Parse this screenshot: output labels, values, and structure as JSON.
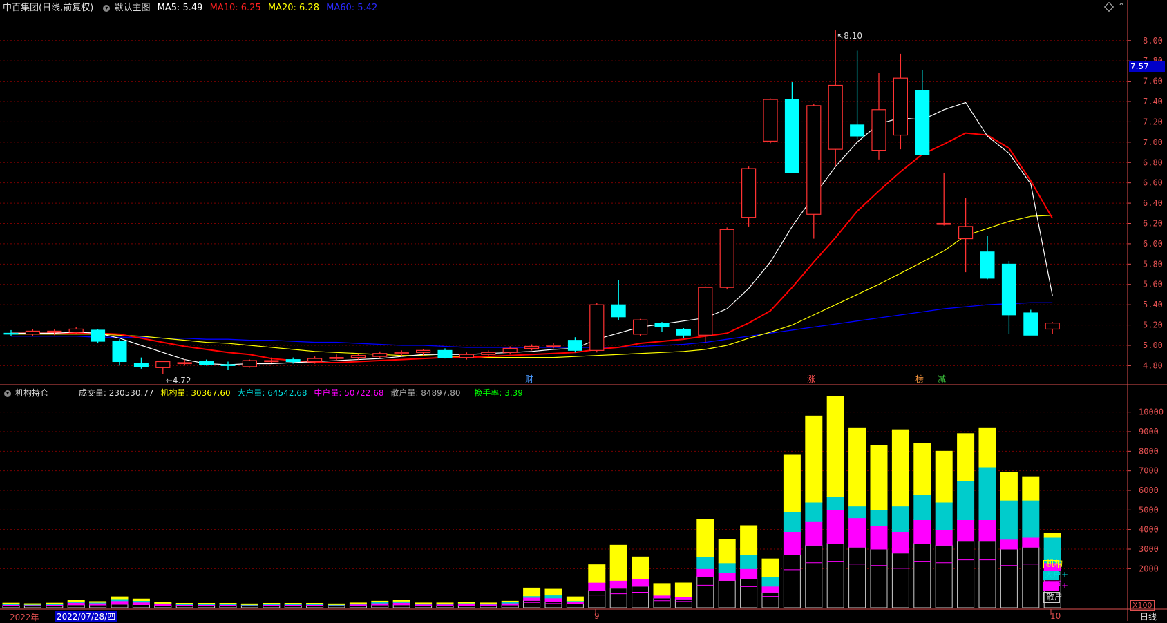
{
  "header": {
    "title": "中百集团",
    "mode": "(日线,前复权)",
    "chart_name": "默认主图",
    "ma5_label": "MA5:",
    "ma5_value": "5.49",
    "ma10_label": "MA10:",
    "ma10_value": "6.25",
    "ma20_label": "MA20:",
    "ma20_value": "6.28",
    "ma60_label": "MA60:",
    "ma60_value": "5.42"
  },
  "indicator_header": {
    "name": "机构持仓",
    "vol_label": "成交量:",
    "vol_value": "230530.77",
    "inst_label": "机构量:",
    "inst_value": "30367.60",
    "big_label": "大户量:",
    "big_value": "64542.68",
    "mid_label": "中户量:",
    "mid_value": "50722.68",
    "retail_label": "散户量:",
    "retail_value": "84897.80",
    "turnover_label": "换手率:",
    "turnover_value": "3.39"
  },
  "price_badge": "7.57",
  "bottom": {
    "year_label": "2022年",
    "date_label": "2022/07/28/四",
    "marker_9": "9",
    "marker_10": "10",
    "period": "日线",
    "unit": "X100"
  },
  "event_markers": [
    "财",
    "涨",
    "榜",
    "减"
  ],
  "legend": [
    {
      "label": "机构-",
      "color": "#ffff00"
    },
    {
      "label": "大户+",
      "color": "#00cccc"
    },
    {
      "label": "中户+",
      "color": "#ff00ff"
    },
    {
      "label": "散户-",
      "color": "#cccccc"
    }
  ],
  "colors": {
    "up": "#ff3232",
    "down": "#00ffff",
    "ma5": "#ffffff",
    "ma10": "#ff0000",
    "ma20": "#ffff00",
    "ma60": "#0000ff",
    "inst": "#ffff00",
    "big": "#00cccc",
    "mid": "#ff00ff",
    "retail": "#cccccc",
    "grid": "#7a0000",
    "axis": "#e05050"
  },
  "chart_data": [
    {
      "type": "candlestick",
      "series": [
        {
          "name": "中百集团"
        }
      ],
      "y_ticks": [
        "8.00",
        "7.80",
        "7.60",
        "7.40",
        "7.20",
        "7.00",
        "6.80",
        "6.60",
        "6.40",
        "6.20",
        "6.00",
        "5.80",
        "5.60",
        "5.40",
        "5.20",
        "5.00",
        "4.80"
      ],
      "ylim": [
        4.66,
        8.25
      ],
      "annotations": {
        "high": "8.10",
        "low": "4.72"
      },
      "candles": [
        [
          5.12,
          5.15,
          5.09,
          5.11
        ],
        [
          5.11,
          5.16,
          5.09,
          5.14
        ],
        [
          5.13,
          5.16,
          5.1,
          5.14
        ],
        [
          5.13,
          5.18,
          5.11,
          5.16
        ],
        [
          5.15,
          5.16,
          5.02,
          5.04
        ],
        [
          5.04,
          5.06,
          4.8,
          4.84
        ],
        [
          4.82,
          4.88,
          4.77,
          4.79
        ],
        [
          4.78,
          4.85,
          4.72,
          4.84
        ],
        [
          4.83,
          4.86,
          4.8,
          4.83
        ],
        [
          4.84,
          4.86,
          4.8,
          4.81
        ],
        [
          4.81,
          4.84,
          4.76,
          4.8
        ],
        [
          4.79,
          4.86,
          4.78,
          4.85
        ],
        [
          4.84,
          4.88,
          4.83,
          4.85
        ],
        [
          4.86,
          4.88,
          4.82,
          4.84
        ],
        [
          4.84,
          4.89,
          4.82,
          4.87
        ],
        [
          4.88,
          4.91,
          4.85,
          4.88
        ],
        [
          4.88,
          4.92,
          4.86,
          4.9
        ],
        [
          4.89,
          4.94,
          4.87,
          4.92
        ],
        [
          4.92,
          4.95,
          4.89,
          4.93
        ],
        [
          4.93,
          4.96,
          4.9,
          4.95
        ],
        [
          4.95,
          4.97,
          4.87,
          4.88
        ],
        [
          4.88,
          4.93,
          4.86,
          4.91
        ],
        [
          4.91,
          4.95,
          4.89,
          4.93
        ],
        [
          4.93,
          4.99,
          4.91,
          4.97
        ],
        [
          4.97,
          5.01,
          4.95,
          4.99
        ],
        [
          4.99,
          5.02,
          4.97,
          5.0
        ],
        [
          5.05,
          5.08,
          4.93,
          4.95
        ],
        [
          4.95,
          5.42,
          4.93,
          5.4
        ],
        [
          5.4,
          5.64,
          5.25,
          5.28
        ],
        [
          5.11,
          5.26,
          5.09,
          5.25
        ],
        [
          5.22,
          5.23,
          5.13,
          5.18
        ],
        [
          5.16,
          5.17,
          5.07,
          5.1
        ],
        [
          5.1,
          5.58,
          5.03,
          5.57
        ],
        [
          5.57,
          6.16,
          5.55,
          6.14
        ],
        [
          6.26,
          6.76,
          6.17,
          6.74
        ],
        [
          7.01,
          7.43,
          6.99,
          7.42
        ],
        [
          7.42,
          7.59,
          6.7,
          6.7
        ],
        [
          6.29,
          7.38,
          6.05,
          7.36
        ],
        [
          6.93,
          8.1,
          6.76,
          7.56
        ],
        [
          7.17,
          7.9,
          7.03,
          7.06
        ],
        [
          6.92,
          7.68,
          6.83,
          7.32
        ],
        [
          7.07,
          7.87,
          6.93,
          7.63
        ],
        [
          7.51,
          7.71,
          6.88,
          6.88
        ],
        [
          6.19,
          6.7,
          6.18,
          6.2
        ],
        [
          6.05,
          6.45,
          5.72,
          6.17
        ],
        [
          5.92,
          6.08,
          5.65,
          5.66
        ],
        [
          5.8,
          5.83,
          5.11,
          5.3
        ],
        [
          5.32,
          5.35,
          5.1,
          5.1
        ],
        [
          5.16,
          5.23,
          5.11,
          5.22
        ]
      ],
      "ma5": [
        5.12,
        5.12,
        5.12,
        5.13,
        5.12,
        5.07,
        5.0,
        4.93,
        4.86,
        4.82,
        4.81,
        4.82,
        4.82,
        4.83,
        4.84,
        4.85,
        4.86,
        4.87,
        4.89,
        4.91,
        4.91,
        4.91,
        4.92,
        4.93,
        4.94,
        4.96,
        4.97,
        5.06,
        5.12,
        5.18,
        5.21,
        5.24,
        5.27,
        5.36,
        5.56,
        5.82,
        6.17,
        6.47,
        6.76,
        7.0,
        7.18,
        7.24,
        7.22,
        7.32,
        7.39,
        7.06,
        6.89,
        6.59,
        5.49
      ],
      "ma10": [
        5.12,
        5.12,
        5.12,
        5.12,
        5.12,
        5.11,
        5.07,
        5.03,
        4.99,
        4.96,
        4.93,
        4.91,
        4.87,
        4.85,
        4.83,
        4.83,
        4.84,
        4.85,
        4.86,
        4.87,
        4.88,
        4.88,
        4.89,
        4.9,
        4.91,
        4.92,
        4.93,
        4.96,
        4.98,
        5.02,
        5.04,
        5.06,
        5.09,
        5.12,
        5.22,
        5.34,
        5.57,
        5.82,
        6.06,
        6.32,
        6.52,
        6.71,
        6.88,
        6.98,
        7.09,
        7.07,
        6.94,
        6.62,
        6.25
      ],
      "ma20": [
        5.11,
        5.11,
        5.11,
        5.11,
        5.11,
        5.1,
        5.09,
        5.07,
        5.05,
        5.03,
        5.02,
        5.0,
        4.98,
        4.96,
        4.94,
        4.93,
        4.92,
        4.91,
        4.9,
        4.9,
        4.89,
        4.89,
        4.88,
        4.88,
        4.88,
        4.88,
        4.89,
        4.9,
        4.91,
        4.92,
        4.93,
        4.94,
        4.96,
        5.0,
        5.07,
        5.13,
        5.2,
        5.3,
        5.4,
        5.5,
        5.6,
        5.71,
        5.82,
        5.93,
        6.08,
        6.15,
        6.22,
        6.27,
        6.28
      ],
      "ma60": [
        5.09,
        5.09,
        5.09,
        5.09,
        5.08,
        5.08,
        5.08,
        5.07,
        5.07,
        5.06,
        5.06,
        5.05,
        5.05,
        5.04,
        5.03,
        5.03,
        5.02,
        5.01,
        5.0,
        5.0,
        4.99,
        4.98,
        4.98,
        4.98,
        4.98,
        4.98,
        4.98,
        4.98,
        4.98,
        4.99,
        5.0,
        5.01,
        5.03,
        5.06,
        5.09,
        5.12,
        5.15,
        5.18,
        5.21,
        5.24,
        5.27,
        5.3,
        5.33,
        5.36,
        5.38,
        5.4,
        5.41,
        5.42,
        5.42
      ]
    },
    {
      "type": "bar",
      "title": "机构持仓",
      "y_ticks": [
        "10000",
        "9000",
        "8000",
        "7000",
        "6000",
        "5000",
        "4000",
        "3000",
        "2000"
      ],
      "ylim": [
        0,
        10800
      ],
      "series": [
        {
          "name": "散户",
          "values": [
            100,
            100,
            100,
            150,
            140,
            180,
            160,
            120,
            100,
            100,
            100,
            90,
            100,
            100,
            100,
            90,
            110,
            140,
            150,
            110,
            110,
            120,
            110,
            140,
            380,
            300,
            200,
            900,
            1000,
            1100,
            500,
            450,
            1600,
            1400,
            1500,
            800,
            2700,
            3200,
            3300,
            3100,
            3000,
            2800,
            3300,
            3200,
            3400,
            3400,
            3000,
            3100,
            1900
          ]
        },
        {
          "name": "中户",
          "values": [
            60,
            50,
            60,
            120,
            100,
            180,
            130,
            80,
            60,
            60,
            60,
            50,
            60,
            60,
            60,
            50,
            70,
            100,
            120,
            70,
            70,
            80,
            70,
            100,
            150,
            200,
            100,
            400,
            400,
            400,
            140,
            120,
            400,
            400,
            500,
            300,
            1200,
            1200,
            1700,
            1500,
            1200,
            1100,
            1200,
            800,
            1100,
            1100,
            500,
            500,
            400
          ]
        },
        {
          "name": "大户",
          "values": [
            40,
            30,
            40,
            50,
            40,
            100,
            80,
            40,
            40,
            40,
            40,
            30,
            40,
            40,
            40,
            30,
            40,
            60,
            70,
            40,
            40,
            50,
            40,
            60,
            80,
            150,
            60,
            0,
            0,
            0,
            0,
            0,
            600,
            500,
            700,
            500,
            1000,
            1000,
            700,
            600,
            800,
            1300,
            1300,
            1400,
            2000,
            2700,
            2000,
            1900,
            1300
          ]
        },
        {
          "name": "机构",
          "values": [
            40,
            30,
            40,
            60,
            40,
            100,
            80,
            30,
            30,
            30,
            30,
            30,
            30,
            30,
            30,
            30,
            30,
            40,
            50,
            30,
            30,
            30,
            30,
            40,
            400,
            300,
            200,
            900,
            1800,
            1100,
            600,
            700,
            1900,
            1200,
            1500,
            900,
            2900,
            4400,
            5100,
            4000,
            3300,
            3900,
            2600,
            2600,
            2400,
            2000,
            1400,
            1200,
            200
          ]
        }
      ]
    }
  ]
}
